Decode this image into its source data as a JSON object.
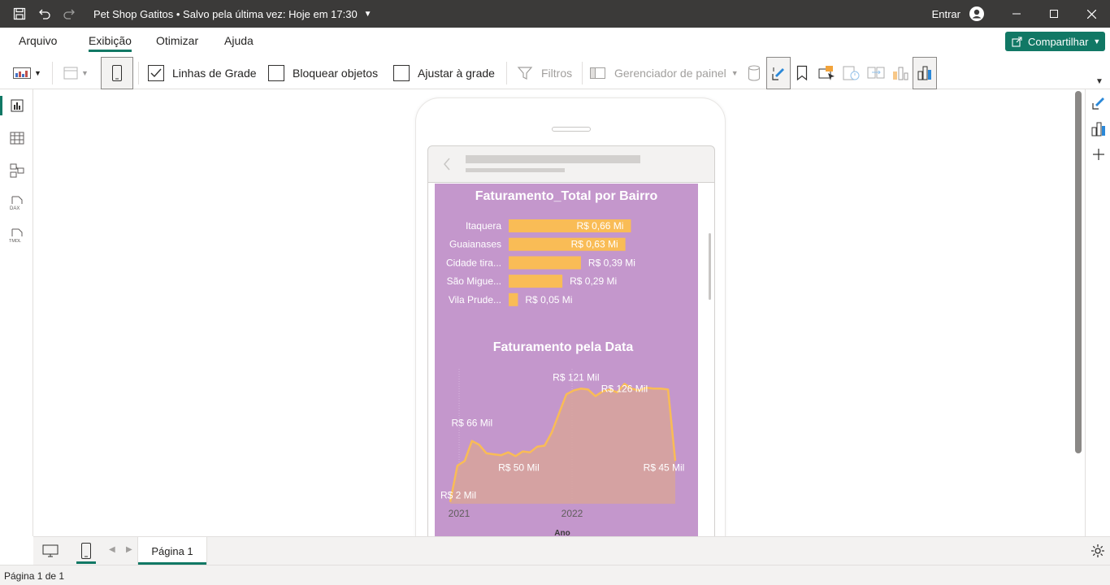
{
  "titlebar": {
    "title": "Pet Shop Gatitos • Salvo pela última vez: Hoje em 17:30",
    "signin": "Entrar"
  },
  "menu": {
    "tabs": [
      "Arquivo",
      "Exibição",
      "Otimizar",
      "Ajuda"
    ],
    "active": "Exibição",
    "share_label": "Compartilhar"
  },
  "ribbon": {
    "gridlines_label": "Linhas de Grade",
    "gridlines_checked": true,
    "lock_label": "Bloquear objetos",
    "lock_checked": false,
    "snap_label": "Ajustar à grade",
    "snap_checked": false,
    "filters_label": "Filtros",
    "panel_manager_label": "Gerenciador de painel"
  },
  "report": {
    "bar_chart": {
      "title": "Faturamento_Total por Bairro"
    },
    "line_chart": {
      "title": "Faturamento pela Data",
      "xlabel": "Ano"
    }
  },
  "chart_data": [
    {
      "type": "bar",
      "orientation": "horizontal",
      "title": "Faturamento_Total por Bairro",
      "categories": [
        "Itaquera",
        "Guaianases",
        "Cidade tira...",
        "São Migue...",
        "Vila Prude..."
      ],
      "values": [
        0.66,
        0.63,
        0.39,
        0.29,
        0.05
      ],
      "data_labels": [
        "R$ 0,66 Mi",
        "R$ 0,63 Mi",
        "R$ 0,39 Mi",
        "R$ 0,29 Mi",
        "R$ 0,05 Mi"
      ],
      "unit": "R$ Mi",
      "color": "#f9bc56"
    },
    {
      "type": "area",
      "title": "Faturamento pela Data",
      "xlabel": "Ano",
      "ylabel": "",
      "x_ticks": [
        "2021",
        "2022"
      ],
      "values": [
        2,
        40,
        45,
        66,
        62,
        53,
        52,
        51,
        54,
        50,
        55,
        54,
        60,
        61,
        75,
        95,
        115,
        119,
        121,
        120,
        113,
        118,
        120,
        117,
        126,
        121,
        119,
        122,
        121,
        121,
        120,
        45
      ],
      "data_labels": [
        {
          "index": 0,
          "text": "R$ 2 Mil"
        },
        {
          "index": 3,
          "text": "R$ 66 Mil"
        },
        {
          "index": 9,
          "text": "R$ 50 Mil"
        },
        {
          "index": 18,
          "text": "R$ 121 Mil"
        },
        {
          "index": 24,
          "text": "R$ 126 Mil"
        },
        {
          "index": 31,
          "text": "R$ 45 Mil"
        }
      ],
      "ylim": [
        0,
        140
      ],
      "line_color": "#f9bc56",
      "fill_color": "#d8a39a"
    }
  ],
  "pages": {
    "current": "Página 1",
    "status": "Página 1 de 1"
  },
  "colors": {
    "accent": "#117865",
    "titlebar": "#3b3a39",
    "report_bg": "#c497cc",
    "bar": "#f9bc56"
  }
}
